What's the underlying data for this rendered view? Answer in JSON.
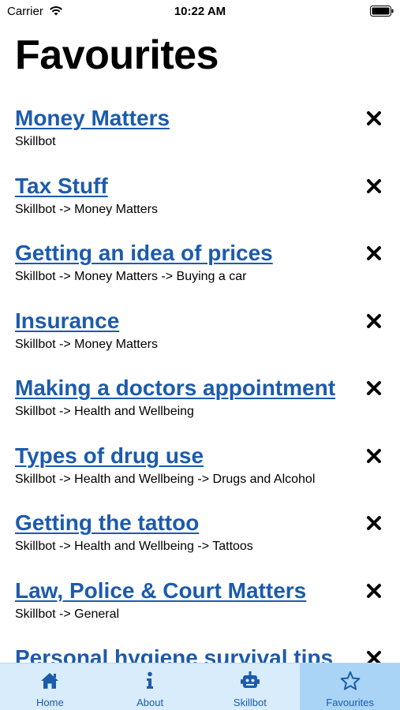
{
  "status_bar": {
    "carrier": "Carrier",
    "time": "10:22 AM"
  },
  "page": {
    "title": "Favourites"
  },
  "favourites": [
    {
      "title": "Money Matters",
      "path": "Skillbot"
    },
    {
      "title": "Tax Stuff",
      "path": "Skillbot -> Money Matters"
    },
    {
      "title": "Getting an idea of prices",
      "path": "Skillbot -> Money Matters -> Buying a car"
    },
    {
      "title": "Insurance",
      "path": "Skillbot -> Money Matters"
    },
    {
      "title": "Making a doctors appointment",
      "path": "Skillbot -> Health and Wellbeing"
    },
    {
      "title": "Types of drug use",
      "path": "Skillbot -> Health and Wellbeing -> Drugs and Alcohol"
    },
    {
      "title": "Getting the tattoo",
      "path": "Skillbot -> Health and Wellbeing -> Tattoos"
    },
    {
      "title": "Law, Police & Court Matters",
      "path": "Skillbot -> General"
    },
    {
      "title": "Personal hygiene survival tips",
      "path": ""
    }
  ],
  "tab_bar": {
    "tabs": [
      {
        "label": "Home",
        "icon": "home-icon"
      },
      {
        "label": "About",
        "icon": "info-icon"
      },
      {
        "label": "Skillbot",
        "icon": "robot-icon"
      },
      {
        "label": "Favourites",
        "icon": "star-icon",
        "active": true
      }
    ]
  },
  "colors": {
    "link": "#1c5bac",
    "tab_bar_bg": "#d8ecfb",
    "tab_active_bg": "#a9d4f5"
  }
}
